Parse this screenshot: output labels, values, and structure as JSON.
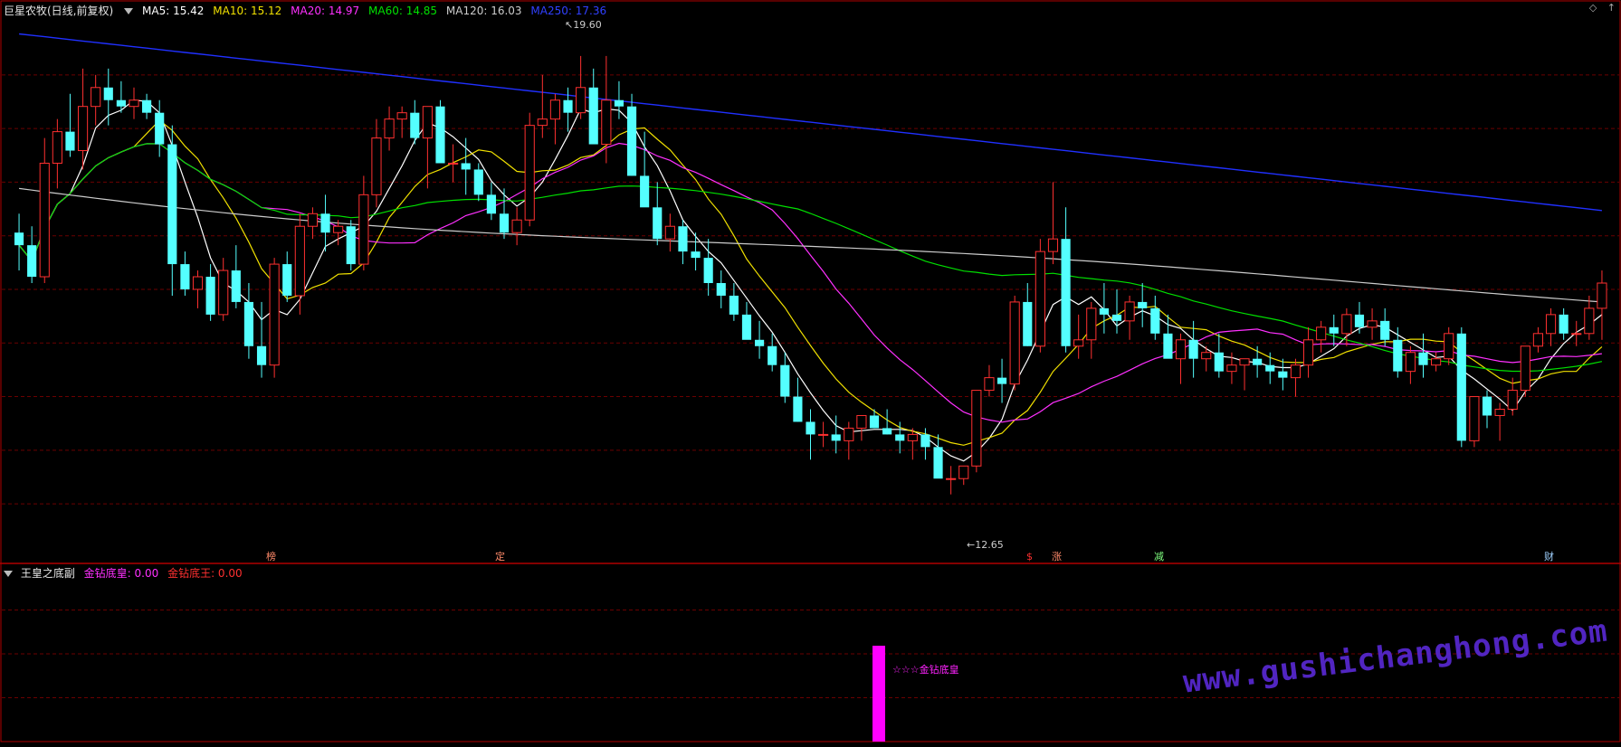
{
  "main_header": {
    "title": "巨星农牧(日线,前复权)",
    "ma": [
      {
        "label": "MA5: 15.42",
        "color": "#ffffff"
      },
      {
        "label": "MA10: 15.12",
        "color": "#f0e000"
      },
      {
        "label": "MA20: 14.97",
        "color": "#ff30ff"
      },
      {
        "label": "MA60: 14.85",
        "color": "#00e000"
      },
      {
        "label": "MA120: 16.03",
        "color": "#cccccc"
      },
      {
        "label": "MA250: 17.36",
        "color": "#2030ff"
      }
    ]
  },
  "window_icons": {
    "diamond": "◇",
    "arrow": "↑"
  },
  "price_labels": {
    "high": "19.60",
    "low": "12.65"
  },
  "signals": [
    {
      "text": "榜",
      "color": "#ff8a6a"
    },
    {
      "text": "定",
      "color": "#ff8a6a"
    },
    {
      "text": "$",
      "color": "#ff3030"
    },
    {
      "text": "涨",
      "color": "#ff8a6a"
    },
    {
      "text": "减",
      "color": "#7fff7f"
    },
    {
      "text": "财",
      "color": "#9fd0ff"
    }
  ],
  "sub_header": {
    "title": "王皇之底副",
    "items": [
      {
        "label": "金钻底皇: 0.00",
        "color": "#ff30ff"
      },
      {
        "label": "金钻底王: 0.00",
        "color": "#ff3030"
      }
    ]
  },
  "sub_bar_label": "☆☆☆金钻底皇",
  "watermark": "www.gushichanghong.com",
  "colors": {
    "up": "#ff3030",
    "down": "#54ffff",
    "grid": "#6b0000",
    "border": "#b00000",
    "ma250": "#2030ff"
  },
  "chart_data": {
    "type": "candlestick",
    "price_ylim": [
      12.0,
      20.0
    ],
    "candles": [
      [
        16.8,
        17.1,
        16.2,
        16.6
      ],
      [
        16.6,
        16.9,
        16.0,
        16.1
      ],
      [
        16.1,
        18.3,
        16.0,
        17.9
      ],
      [
        17.9,
        18.6,
        17.5,
        18.4
      ],
      [
        18.4,
        19.0,
        18.0,
        18.1
      ],
      [
        18.1,
        19.4,
        17.8,
        18.8
      ],
      [
        18.8,
        19.3,
        18.5,
        19.1
      ],
      [
        19.1,
        19.4,
        18.5,
        18.9
      ],
      [
        18.9,
        19.2,
        18.7,
        18.8
      ],
      [
        18.8,
        19.1,
        18.6,
        18.9
      ],
      [
        18.9,
        19.0,
        18.6,
        18.7
      ],
      [
        18.7,
        18.9,
        18.0,
        18.2
      ],
      [
        18.2,
        18.5,
        15.8,
        16.3
      ],
      [
        16.3,
        16.5,
        15.8,
        15.9
      ],
      [
        15.9,
        16.2,
        15.6,
        16.1
      ],
      [
        16.1,
        16.3,
        15.4,
        15.5
      ],
      [
        15.5,
        16.4,
        15.4,
        16.2
      ],
      [
        16.2,
        16.6,
        15.6,
        15.7
      ],
      [
        15.7,
        16.0,
        14.8,
        15.0
      ],
      [
        15.0,
        15.7,
        14.5,
        14.7
      ],
      [
        14.7,
        16.4,
        14.5,
        16.3
      ],
      [
        16.3,
        16.5,
        15.7,
        15.8
      ],
      [
        15.8,
        17.1,
        15.5,
        16.9
      ],
      [
        16.9,
        17.2,
        16.7,
        17.1
      ],
      [
        17.1,
        17.4,
        16.5,
        16.8
      ],
      [
        16.8,
        17.0,
        16.6,
        16.9
      ],
      [
        16.9,
        17.0,
        16.2,
        16.3
      ],
      [
        16.3,
        17.7,
        16.2,
        17.4
      ],
      [
        17.4,
        18.6,
        17.2,
        18.3
      ],
      [
        18.3,
        18.8,
        18.1,
        18.6
      ],
      [
        18.6,
        18.8,
        18.3,
        18.7
      ],
      [
        18.7,
        18.9,
        18.2,
        18.3
      ],
      [
        18.3,
        18.8,
        17.5,
        18.8
      ],
      [
        18.8,
        18.9,
        18.4,
        17.9
      ],
      [
        17.9,
        18.2,
        17.6,
        17.9
      ],
      [
        17.9,
        18.3,
        17.4,
        17.8
      ],
      [
        17.8,
        17.9,
        17.3,
        17.4
      ],
      [
        17.4,
        17.6,
        17.0,
        17.1
      ],
      [
        17.1,
        17.5,
        16.7,
        16.8
      ],
      [
        16.8,
        17.2,
        16.6,
        17.0
      ],
      [
        17.0,
        18.7,
        16.9,
        18.5
      ],
      [
        18.5,
        19.3,
        18.3,
        18.6
      ],
      [
        18.6,
        19.0,
        18.2,
        18.9
      ],
      [
        18.9,
        19.1,
        18.4,
        18.7
      ],
      [
        18.7,
        19.6,
        18.6,
        19.1
      ],
      [
        19.1,
        19.4,
        18.5,
        18.2
      ],
      [
        18.2,
        19.6,
        17.9,
        18.9
      ],
      [
        18.9,
        19.2,
        18.6,
        18.8
      ],
      [
        18.8,
        19.0,
        17.7,
        17.7
      ],
      [
        17.7,
        18.4,
        17.3,
        17.2
      ],
      [
        17.2,
        17.6,
        16.6,
        16.7
      ],
      [
        16.7,
        17.1,
        16.5,
        16.9
      ],
      [
        16.9,
        17.0,
        16.3,
        16.5
      ],
      [
        16.5,
        16.8,
        16.2,
        16.4
      ],
      [
        16.4,
        16.7,
        15.8,
        16.0
      ],
      [
        16.0,
        16.2,
        15.6,
        15.8
      ],
      [
        15.8,
        16.0,
        15.4,
        15.5
      ],
      [
        15.5,
        15.7,
        15.2,
        15.1
      ],
      [
        15.1,
        15.4,
        14.8,
        15.0
      ],
      [
        15.0,
        15.2,
        14.6,
        14.7
      ],
      [
        14.7,
        14.9,
        14.1,
        14.2
      ],
      [
        14.2,
        14.5,
        13.8,
        13.8
      ],
      [
        13.8,
        14.0,
        13.2,
        13.6
      ],
      [
        13.6,
        13.8,
        13.4,
        13.6
      ],
      [
        13.6,
        13.9,
        13.3,
        13.5
      ],
      [
        13.5,
        13.8,
        13.2,
        13.7
      ],
      [
        13.7,
        13.9,
        13.5,
        13.9
      ],
      [
        13.9,
        14.0,
        13.7,
        13.7
      ],
      [
        13.7,
        14.0,
        13.6,
        13.6
      ],
      [
        13.6,
        13.8,
        13.3,
        13.5
      ],
      [
        13.5,
        13.7,
        13.2,
        13.6
      ],
      [
        13.6,
        13.7,
        13.2,
        13.4
      ],
      [
        13.4,
        13.6,
        13.0,
        12.9
      ],
      [
        12.9,
        13.1,
        12.65,
        12.9
      ],
      [
        12.9,
        13.1,
        12.8,
        13.1
      ],
      [
        13.1,
        14.0,
        13.0,
        14.3
      ],
      [
        14.3,
        14.7,
        14.2,
        14.5
      ],
      [
        14.5,
        14.8,
        14.1,
        14.4
      ],
      [
        14.4,
        15.8,
        14.3,
        15.7
      ],
      [
        15.7,
        16.0,
        15.0,
        15.0
      ],
      [
        15.0,
        16.7,
        14.9,
        16.5
      ],
      [
        16.5,
        17.6,
        16.3,
        16.7
      ],
      [
        16.7,
        17.2,
        14.9,
        15.0
      ],
      [
        15.0,
        15.5,
        14.8,
        15.1
      ],
      [
        15.1,
        15.7,
        14.8,
        15.6
      ],
      [
        15.6,
        16.0,
        15.2,
        15.5
      ],
      [
        15.5,
        15.9,
        15.2,
        15.4
      ],
      [
        15.4,
        15.8,
        15.1,
        15.7
      ],
      [
        15.7,
        16.0,
        15.3,
        15.6
      ],
      [
        15.6,
        15.8,
        15.1,
        15.2
      ],
      [
        15.2,
        15.5,
        14.9,
        14.8
      ],
      [
        14.8,
        15.2,
        14.4,
        15.1
      ],
      [
        15.1,
        15.4,
        14.5,
        14.8
      ],
      [
        14.8,
        15.0,
        14.6,
        14.9
      ],
      [
        14.9,
        15.2,
        14.5,
        14.6
      ],
      [
        14.6,
        14.9,
        14.4,
        14.7
      ],
      [
        14.7,
        14.8,
        14.3,
        14.8
      ],
      [
        14.8,
        15.0,
        14.5,
        14.7
      ],
      [
        14.7,
        14.9,
        14.4,
        14.6
      ],
      [
        14.6,
        14.8,
        14.3,
        14.5
      ],
      [
        14.5,
        14.8,
        14.2,
        14.7
      ],
      [
        14.7,
        15.3,
        14.5,
        15.1
      ],
      [
        15.1,
        15.4,
        14.9,
        15.3
      ],
      [
        15.3,
        15.5,
        15.0,
        15.2
      ],
      [
        15.2,
        15.6,
        15.0,
        15.5
      ],
      [
        15.5,
        15.7,
        15.2,
        15.3
      ],
      [
        15.3,
        15.6,
        15.1,
        15.4
      ],
      [
        15.4,
        15.6,
        15.0,
        15.1
      ],
      [
        15.1,
        15.3,
        14.5,
        14.6
      ],
      [
        14.6,
        15.0,
        14.4,
        14.9
      ],
      [
        14.9,
        15.2,
        14.5,
        14.7
      ],
      [
        14.7,
        14.9,
        14.6,
        14.8
      ],
      [
        14.8,
        15.3,
        14.7,
        15.2
      ],
      [
        15.2,
        15.3,
        13.4,
        13.5
      ],
      [
        13.5,
        14.2,
        13.4,
        14.2
      ],
      [
        14.2,
        14.3,
        13.7,
        13.9
      ],
      [
        13.9,
        14.1,
        13.5,
        14.0
      ],
      [
        14.0,
        14.5,
        13.9,
        14.3
      ],
      [
        14.3,
        15.0,
        14.2,
        15.0
      ],
      [
        15.0,
        15.3,
        14.9,
        15.2
      ],
      [
        15.2,
        15.6,
        15.0,
        15.5
      ],
      [
        15.5,
        15.6,
        15.1,
        15.2
      ],
      [
        15.2,
        15.4,
        15.0,
        15.2
      ],
      [
        15.2,
        15.8,
        15.1,
        15.6
      ],
      [
        15.6,
        16.2,
        15.1,
        16.0
      ]
    ],
    "sub_ylim": [
      0,
      1
    ],
    "sub_series": [
      {
        "name": "金钻底皇",
        "signal_index": 96,
        "value": 1
      }
    ]
  }
}
